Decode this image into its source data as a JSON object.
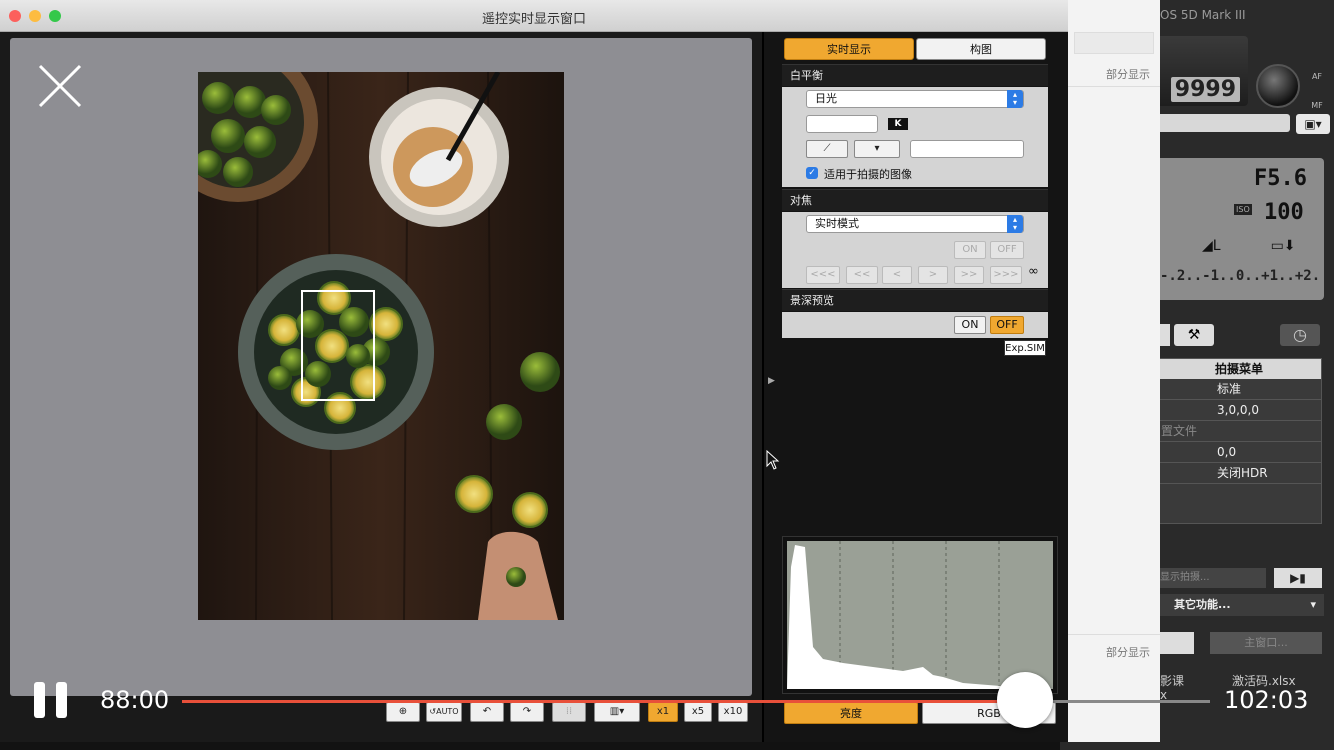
{
  "window": {
    "title": "遥控实时显示窗口"
  },
  "background_app": {
    "title": "OS 5D Mark III",
    "shots_remaining": "9999",
    "af_label": "AF",
    "mf_label": "MF",
    "aperture": "F5.6",
    "iso_label": "ISO",
    "iso": "100",
    "exposure_scale": "-.2..-1..0..+1..+2.",
    "shooting_menu": {
      "header": "拍摄菜单",
      "rows": [
        "标准",
        "3,0,0,0",
        "置文件",
        "0,0",
        "关闭HDR"
      ]
    },
    "live_shoot": "显示拍摄...",
    "other_functions": "其它功能...",
    "main_window": "主窗口...",
    "partial_display": "部分显示",
    "file1": "影课",
    "file1_ext": "x",
    "file2": "激活码.xlsx"
  },
  "panel": {
    "tab_live": "实时显示",
    "tab_compose": "构图",
    "wb_section": "白平衡",
    "wb_value": "日光",
    "k_label": "K",
    "apply_to_shots": "适用于拍摄的图像",
    "focus_section": "对焦",
    "focus_mode": "实时模式",
    "on": "ON",
    "off": "OFF",
    "focus_buttons": [
      "<<<",
      "<<",
      "<",
      ">",
      ">>",
      ">>>"
    ],
    "infinity": "∞",
    "dof_section": "景深预览",
    "dof_on": "ON",
    "dof_off": "OFF",
    "exp_sim": "Exp.SIM",
    "hist_brightness": "亮度",
    "hist_rgb": "RGB"
  },
  "toolbar": {
    "auto": "AUTO",
    "x1": "x1",
    "x5": "x5",
    "x10": "x10"
  },
  "player": {
    "current_time": "88:00",
    "total_time": "102:03",
    "progress": 0.82
  },
  "colors": {
    "accent": "#f0a830",
    "progress": "#e8503a",
    "preview_bg": "#8e8e93"
  }
}
